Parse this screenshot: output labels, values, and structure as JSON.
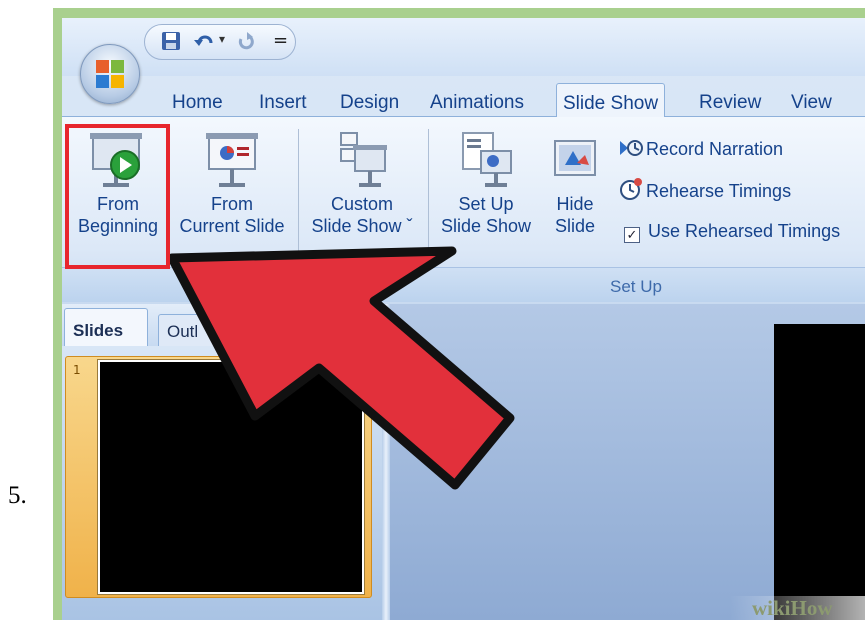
{
  "step_number": "5.",
  "quick_access": {
    "save_icon": "save-icon",
    "undo_icon": "undo-icon",
    "redo_icon": "redo-icon",
    "customize": "="
  },
  "tabs": [
    "Home",
    "Insert",
    "Design",
    "Animations",
    "Slide Show",
    "Review",
    "View"
  ],
  "active_tab": "Slide Show",
  "ribbon": {
    "from_beginning": [
      "From",
      "Beginning"
    ],
    "from_current_slide": [
      "From",
      "Current Slide"
    ],
    "custom_slide_show": [
      "Custom",
      "Slide Show ˇ"
    ],
    "set_up_slide_show": [
      "Set Up",
      "Slide Show"
    ],
    "hide_slide": [
      "Hide",
      "Slide"
    ],
    "record_narration": "Record Narration",
    "rehearse_timings": "Rehearse Timings",
    "use_rehearsed_timings": "Use Rehearsed Timings",
    "use_rehearsed_checked": true,
    "group_label": "Set Up"
  },
  "panel_tabs": [
    "Slides",
    "Outl"
  ],
  "slide_thumbnail_number": "1",
  "watermark": "wikiHow",
  "colors": {
    "highlight": "#e7262d",
    "arrow_fill": "#e2303b",
    "accent_text": "#15428b"
  }
}
